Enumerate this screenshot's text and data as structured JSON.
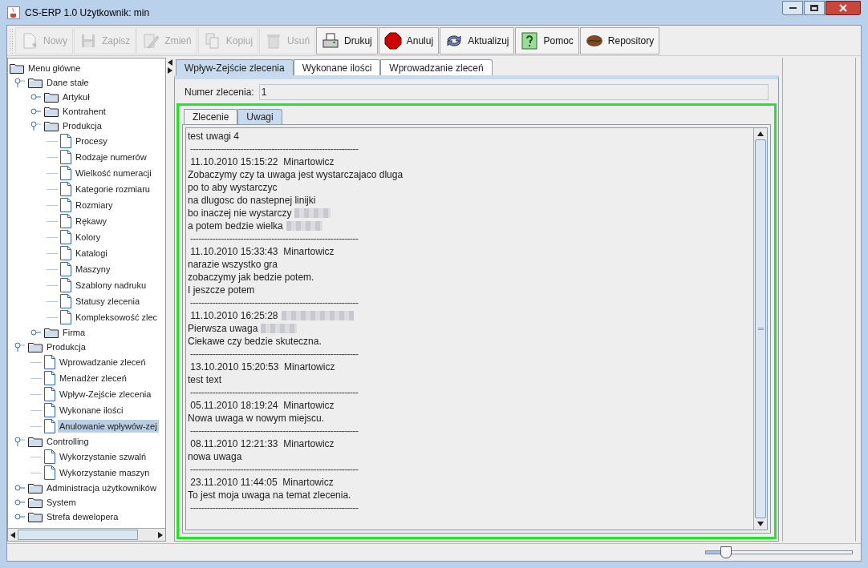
{
  "window": {
    "title": "CS-ERP 1.0  Użytkownik: min"
  },
  "toolbar": [
    {
      "label": "Nowy",
      "disabled": true
    },
    {
      "label": "Zapisz",
      "disabled": true
    },
    {
      "label": "Zmień",
      "disabled": true
    },
    {
      "label": "Kopiuj",
      "disabled": true
    },
    {
      "label": "Usuń",
      "disabled": true
    },
    {
      "label": "Drukuj",
      "disabled": false
    },
    {
      "label": "Anuluj",
      "disabled": false
    },
    {
      "label": "Aktualizuj",
      "disabled": false
    },
    {
      "label": "Pomoc",
      "disabled": false
    },
    {
      "label": "Repository",
      "disabled": false
    }
  ],
  "tree": [
    {
      "label": "Menu główne",
      "kind": "root",
      "selected": false,
      "children": [
        {
          "label": "Dane stałe",
          "kind": "folder",
          "expanded": true,
          "selected": false,
          "children": [
            {
              "label": "Artykuł",
              "kind": "folder",
              "expanded": false,
              "selected": false
            },
            {
              "label": "Kontrahent",
              "kind": "folder",
              "expanded": false,
              "selected": false
            },
            {
              "label": "Produkcja",
              "kind": "folder",
              "expanded": true,
              "selected": false,
              "children": [
                {
                  "label": "Procesy",
                  "kind": "leaf",
                  "selected": false
                },
                {
                  "label": "Rodzaje numerów",
                  "kind": "leaf",
                  "selected": false
                },
                {
                  "label": "Wielkość numeracji",
                  "kind": "leaf",
                  "selected": false
                },
                {
                  "label": "Kategorie rozmiaru",
                  "kind": "leaf",
                  "selected": false
                },
                {
                  "label": "Rozmiary",
                  "kind": "leaf",
                  "selected": false
                },
                {
                  "label": "Rękawy",
                  "kind": "leaf",
                  "selected": false
                },
                {
                  "label": "Kolory",
                  "kind": "leaf",
                  "selected": false
                },
                {
                  "label": "Katalogi",
                  "kind": "leaf",
                  "selected": false
                },
                {
                  "label": "Maszyny",
                  "kind": "leaf",
                  "selected": false
                },
                {
                  "label": "Szablony nadruku",
                  "kind": "leaf",
                  "selected": false
                },
                {
                  "label": "Statusy zlecenia",
                  "kind": "leaf",
                  "selected": false
                },
                {
                  "label": "Kompleksowość zlec",
                  "kind": "leaf",
                  "selected": false
                }
              ]
            },
            {
              "label": "Firma",
              "kind": "folder",
              "expanded": false,
              "selected": false
            }
          ]
        },
        {
          "label": "Produkcja",
          "kind": "folder",
          "expanded": true,
          "selected": false,
          "children": [
            {
              "label": "Wprowadzanie zleceń",
              "kind": "leaf",
              "selected": false
            },
            {
              "label": "Menadżer zleceń",
              "kind": "leaf",
              "selected": false
            },
            {
              "label": "Wpływ-Zejście zlecenia",
              "kind": "leaf",
              "selected": false
            },
            {
              "label": "Wykonane ilości",
              "kind": "leaf",
              "selected": false
            },
            {
              "label": "Anulowanie wpływów-zej",
              "kind": "leaf",
              "selected": true
            }
          ]
        },
        {
          "label": "Controlling",
          "kind": "folder",
          "expanded": true,
          "selected": false,
          "children": [
            {
              "label": "Wykorzystanie szwalń",
              "kind": "leaf",
              "selected": false
            },
            {
              "label": "Wykorzystanie maszyn",
              "kind": "leaf",
              "selected": false
            }
          ]
        },
        {
          "label": "Administracja użytkowników",
          "kind": "folder",
          "expanded": false,
          "selected": false
        },
        {
          "label": "System",
          "kind": "folder",
          "expanded": false,
          "selected": false
        },
        {
          "label": "Strefa dewelopera",
          "kind": "folder",
          "expanded": false,
          "selected": false
        }
      ]
    }
  ],
  "tabs": [
    {
      "label": "Wpływ-Zejście zlecenia",
      "selected": true
    },
    {
      "label": "Wykonane ilości",
      "selected": false
    },
    {
      "label": "Wprowadzanie zleceń",
      "selected": false
    }
  ],
  "order_field": {
    "label": "Numer zlecenia:",
    "value": "1"
  },
  "inner_tabs": [
    {
      "label": "Zlecenie",
      "selected": false
    },
    {
      "label": "Uwagi",
      "selected": true
    }
  ],
  "notes": [
    {
      "kind": "text",
      "text": "test uwagi 4",
      "redacted": false
    },
    {
      "kind": "separator",
      "text": " ------------------------------------------------------------"
    },
    {
      "kind": "header",
      "text": " 11.10.2010 15:15:22  Minartowicz",
      "redacted": false
    },
    {
      "kind": "text",
      "text": "Zobaczymy czy ta uwaga jest wystarczajaco dluga",
      "redacted": false
    },
    {
      "kind": "text",
      "text": "po to aby wystarczyc",
      "redacted": false
    },
    {
      "kind": "text",
      "text": "na dlugosc do nastepnej linijki",
      "redacted": false
    },
    {
      "kind": "text",
      "text": "bo inaczej nie wystarczy",
      "redacted": true
    },
    {
      "kind": "text",
      "text": "a potem bedzie wielka",
      "redacted": true
    },
    {
      "kind": "separator",
      "text": " ------------------------------------------------------------"
    },
    {
      "kind": "header",
      "text": " 11.10.2010 15:33:43  Minartowicz",
      "redacted": false
    },
    {
      "kind": "text",
      "text": "narazie wszystko gra",
      "redacted": false
    },
    {
      "kind": "text",
      "text": "zobaczymy jak bedzie potem.",
      "redacted": false
    },
    {
      "kind": "text",
      "text": "I jeszcze potem",
      "redacted": false
    },
    {
      "kind": "separator",
      "text": " ------------------------------------------------------------"
    },
    {
      "kind": "header",
      "text": " 11.10.2010 16:25:28",
      "redacted": true
    },
    {
      "kind": "text",
      "text": "Pierwsza uwaga",
      "redacted": true
    },
    {
      "kind": "text",
      "text": "Ciekawe czy bedzie skuteczna.",
      "redacted": false
    },
    {
      "kind": "separator",
      "text": " ------------------------------------------------------------"
    },
    {
      "kind": "header",
      "text": " 13.10.2010 15:20:53  Minartowicz",
      "redacted": false
    },
    {
      "kind": "text",
      "text": "test text",
      "redacted": false
    },
    {
      "kind": "separator",
      "text": " ------------------------------------------------------------"
    },
    {
      "kind": "header",
      "text": " 05.11.2010 18:19:24  Minartowicz",
      "redacted": false
    },
    {
      "kind": "text",
      "text": "Nowa uwaga w nowym miejscu.",
      "redacted": false
    },
    {
      "kind": "separator",
      "text": " ------------------------------------------------------------"
    },
    {
      "kind": "header",
      "text": " 08.11.2010 12:21:33  Minartowicz",
      "redacted": false
    },
    {
      "kind": "text",
      "text": "nowa uwaga",
      "redacted": false
    },
    {
      "kind": "separator",
      "text": " ------------------------------------------------------------"
    },
    {
      "kind": "header",
      "text": " 23.11.2010 11:44:05  Minartowicz",
      "redacted": false
    },
    {
      "kind": "text",
      "text": "To jest moja uwaga na temat zlecenia.",
      "redacted": false
    },
    {
      "kind": "separator",
      "text": " ------------------------------------------------------------"
    }
  ],
  "zoom_slider": {
    "level": 0.14
  }
}
